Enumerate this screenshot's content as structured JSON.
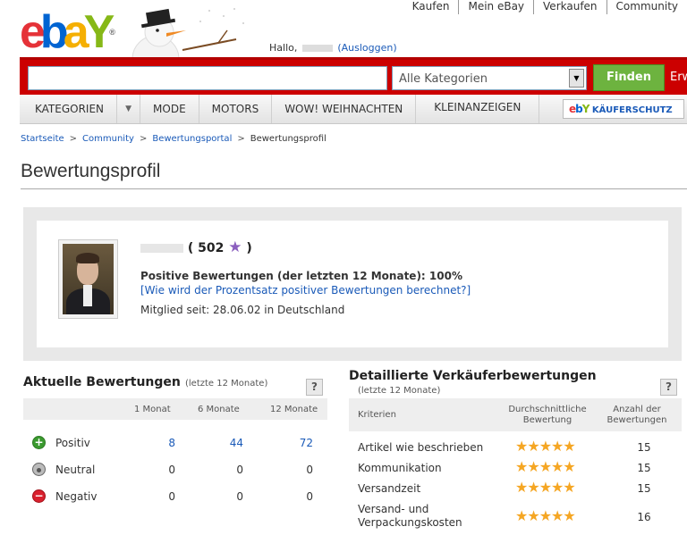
{
  "toplinks": [
    "Kaufen",
    "Mein eBay",
    "Verkaufen",
    "Community"
  ],
  "logo": {
    "e": "e",
    "b": "b",
    "a": "a",
    "y": "Y",
    "reg": "®"
  },
  "greeting": {
    "hello": "Hallo,",
    "logout": "(Ausloggen)"
  },
  "search": {
    "placeholder": "",
    "category": "Alle Kategorien",
    "find_label": "Finden",
    "extra": "Erw"
  },
  "nav": {
    "items": [
      "KATEGORIEN",
      "MODE",
      "MOTORS",
      "WOW! WEIHNACHTEN",
      "KLEINANZEIGEN"
    ],
    "kaeuferschutz": "KÄUFERSCHUTZ"
  },
  "breadcrumb": [
    "Startseite",
    "Community",
    "Bewertungsportal",
    "Bewertungsprofil"
  ],
  "page_title": "Bewertungsprofil",
  "profile": {
    "score": "502",
    "positive_text": "Positive Bewertungen (der letzten 12 Monate): 100%",
    "how_link": "[Wie wird der Prozentsatz positiver Bewertungen berechnet?]",
    "member_since": "Mitglied seit: 28.06.02 in Deutschland"
  },
  "current_ratings": {
    "title": "Aktuelle Bewertungen",
    "subtitle": "(letzte 12 Monate)",
    "columns": [
      "1 Monat",
      "6 Monate",
      "12 Monate"
    ],
    "rows": [
      {
        "label": "Positiv",
        "values": [
          "8",
          "44",
          "72"
        ]
      },
      {
        "label": "Neutral",
        "values": [
          "0",
          "0",
          "0"
        ]
      },
      {
        "label": "Negativ",
        "values": [
          "0",
          "0",
          "0"
        ]
      }
    ],
    "colors": {
      "positive": "#3b9a2f",
      "neutral": "#9a9a9a",
      "negative": "#d9202e",
      "link": "#1a5ab8"
    }
  },
  "detailed_ratings": {
    "title": "Detaillierte Verkäuferbewertungen",
    "subtitle": "(letzte 12 Monate)",
    "col_criteria": "Kriterien",
    "col_avg_1": "Durchschnittliche",
    "col_avg_2": "Bewertung",
    "col_count_1": "Anzahl der",
    "col_count_2": "Bewertungen",
    "rows": [
      {
        "label": "Artikel wie beschrieben",
        "stars": 5,
        "count": "15"
      },
      {
        "label": "Kommunikation",
        "stars": 5,
        "count": "15"
      },
      {
        "label": "Versandzeit",
        "stars": 5,
        "count": "15"
      },
      {
        "label_1": "Versand- und",
        "label_2": "Verpackungskosten",
        "stars": 5,
        "count": "16"
      }
    ]
  },
  "help_label": "?"
}
